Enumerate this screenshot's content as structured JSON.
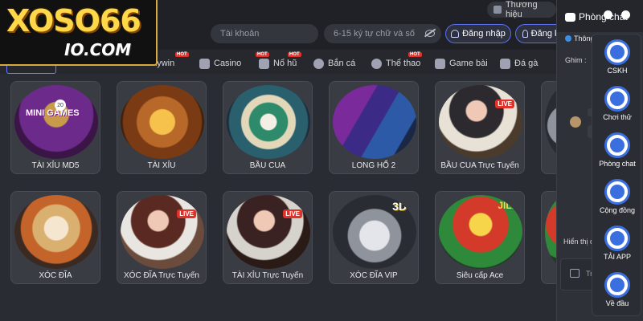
{
  "header": {
    "language_label": "Thương hiệu",
    "username_placeholder": "Tài khoản",
    "password_placeholder": "6-15 ký tự chữ và số",
    "login_label": "Đăng nhập",
    "register_label": "Đăng ký"
  },
  "logo": {
    "main": "XOSO66",
    "sub": "IO.COM"
  },
  "nav": {
    "items": [
      {
        "label": "Luckywin",
        "icon": "luckywin-icon",
        "hot": true
      },
      {
        "label": "Casino",
        "icon": "casino-icon",
        "hot": true
      },
      {
        "label": "Nổ hũ",
        "icon": "slots-icon",
        "hot": true
      },
      {
        "label": "Bắn cá",
        "icon": "fish-icon",
        "hot": false
      },
      {
        "label": "Thể thao",
        "icon": "sports-icon",
        "hot": true
      },
      {
        "label": "Game bài",
        "icon": "cards-icon",
        "hot": false
      },
      {
        "label": "Đá gà",
        "icon": "cockfight-icon",
        "hot": false
      }
    ],
    "hot_label": "HOT"
  },
  "games": [
    {
      "title": "TÀI XỈU MD5",
      "art": "a1"
    },
    {
      "title": "TÀI XỈU",
      "art": "a2"
    },
    {
      "title": "BẦU CUA",
      "art": "a3"
    },
    {
      "title": "LONG HỔ 2",
      "art": "a4"
    },
    {
      "title": "BẦU CUA Trực Tuyến",
      "art": "a5"
    },
    {
      "title": "XÓC ĐĨA",
      "art": "a6"
    },
    {
      "title": "XÓC ĐĨA Trực Tuyến",
      "art": "a7"
    },
    {
      "title": "TÀI XỈU Trực Tuyến",
      "art": "a8"
    },
    {
      "title": "XÓC ĐĨA VIP",
      "art": "a9"
    },
    {
      "title": "Siêu cấp Ace",
      "art": "a10"
    }
  ],
  "badges": {
    "live": "LIVE",
    "three_d": "3D",
    "jili": "JILI",
    "mini_games": "MINI GAMES",
    "round": "20"
  },
  "chat": {
    "title": "Phòng chat",
    "notice": "Thông b",
    "pin_label": "Ghim :",
    "show_label": "Hiển thị đơn",
    "input_placeholder": "Tr",
    "dot_colors": [
      "#ffffff",
      "#ffffff"
    ]
  },
  "rail": [
    {
      "label": "CSKH",
      "icon": "support-icon"
    },
    {
      "label": "Chơi thử",
      "icon": "demo-play-icon"
    },
    {
      "label": "Phòng chat",
      "icon": "chat-icon"
    },
    {
      "label": "Cộng đồng",
      "icon": "telegram-icon"
    },
    {
      "label": "TẢI APP",
      "icon": "app-download-icon"
    },
    {
      "label": "Về đầu",
      "icon": "back-to-top-icon"
    }
  ]
}
